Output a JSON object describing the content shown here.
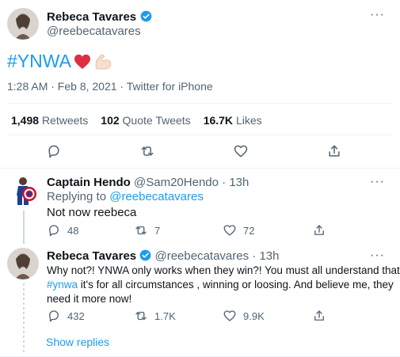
{
  "main_tweet": {
    "author_name": "Rebeca Tavares",
    "author_handle": "@reebecatavares",
    "text_hashtag": "#YNWA",
    "timestamp": "1:28 AM · Feb 8, 2021 · Twitter for iPhone",
    "stats": {
      "retweets_count": "1,498",
      "retweets_label": "Retweets",
      "quotes_count": "102",
      "quotes_label": "Quote Tweets",
      "likes_count": "16.7K",
      "likes_label": "Likes"
    }
  },
  "reply1": {
    "author_name": "Captain Hendo",
    "author_handle": "@Sam20Hendo",
    "time": "· 13h",
    "replying_prefix": "Replying to",
    "replying_to": "@reebecatavares",
    "text": "Not now reebeca",
    "reply_count": "48",
    "retweet_count": "7",
    "like_count": "72"
  },
  "reply2": {
    "author_name": "Rebeca Tavares",
    "author_handle": "@reebecatavares",
    "time": "· 13h",
    "text_line1": "Why not?! YNWA only works when they win?! You must all understand that",
    "text_hashtag": "#ynwa",
    "text_line2_rest": " it's for all circumstances , winning or loosing.  And believe me, they",
    "text_line3": "need it more now!",
    "reply_count": "432",
    "retweet_count": "1.7K",
    "like_count": "9.9K",
    "show_replies": "Show replies"
  },
  "colors": {
    "accent": "#1d9bf0",
    "text": "#0f1419",
    "muted": "#536471",
    "divider": "#eff3f4"
  }
}
